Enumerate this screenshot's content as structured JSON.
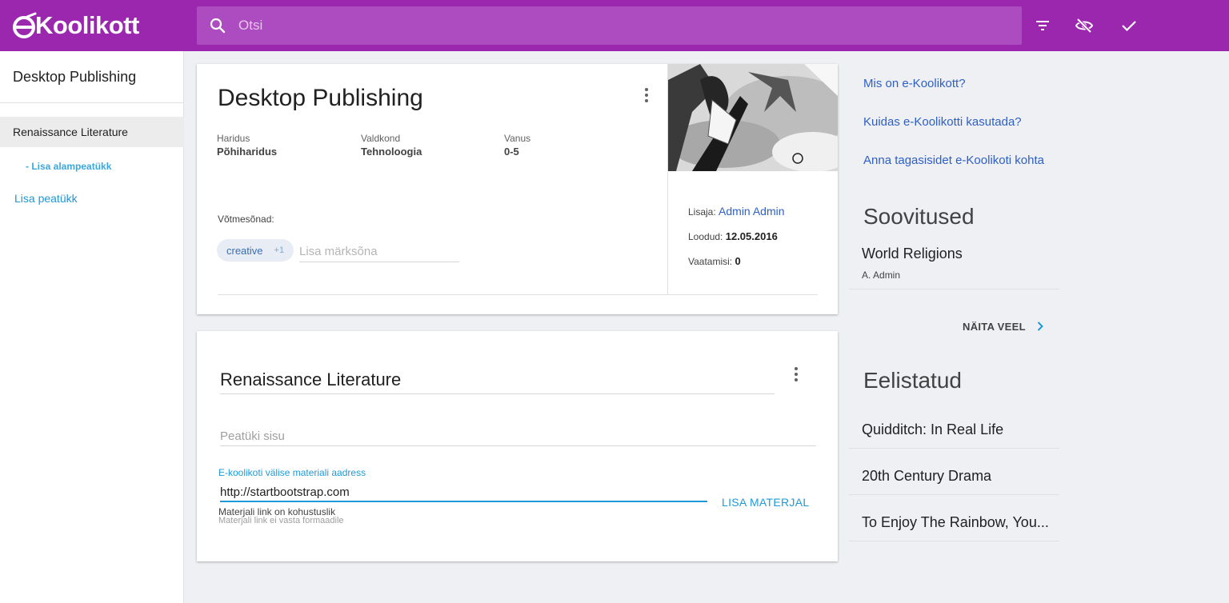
{
  "header": {
    "logo_text": "Koolikott",
    "search_placeholder": "Otsi",
    "icons": [
      "search-icon",
      "filter-icon",
      "visibility-off-icon",
      "check-icon"
    ],
    "colors": {
      "primary": "#9b27af",
      "search_bg": "#ad4bc0"
    }
  },
  "sidebar": {
    "title": "Desktop Publishing",
    "chapter": "Renaissance Literature",
    "add_subchapter": "- Lisa alampeatükk",
    "add_chapter": "Lisa peatükk"
  },
  "portfolio": {
    "title": "Desktop Publishing",
    "meta": [
      {
        "label": "Haridus",
        "value": "Põhiharidus"
      },
      {
        "label": "Valdkond",
        "value": "Tehnoloogia"
      },
      {
        "label": "Vanus",
        "value": "0-5"
      }
    ],
    "keywords_label": "Võtmesõnad:",
    "tag": "creative",
    "tag_extra": "+1",
    "keyword_placeholder": "Lisa märksõna",
    "creator_label": "Lisaja:",
    "creator": "Admin Admin",
    "created_label": "Loodud:",
    "created": "12.05.2016",
    "views_label": "Vaatamisi:",
    "views": "0"
  },
  "chapter": {
    "title": "Renaissance Literature",
    "content_placeholder": "Peatüki sisu",
    "url_label": "E-koolikoti välise materiali aadress",
    "url_value": "http://startbootstrap.com",
    "error_required": "Materjali link on kohustuslik",
    "error_format": "Materjali link ei vasta formaadile",
    "add_material": "LISA MATERJAL"
  },
  "right": {
    "links": [
      "Mis on e-Koolikott?",
      "Kuidas e-Koolikotti kasutada?",
      "Anna tagasisidet e-Koolikoti kohta"
    ],
    "recommendations_title": "Soovitused",
    "recommendation": {
      "title": "World Religions",
      "author": "A. Admin"
    },
    "show_more": "NÄITA VEEL",
    "favorites_title": "Eelistatud",
    "favorites": [
      "Quidditch: In Real Life",
      "20th Century Drama",
      "To Enjoy The Rainbow, You..."
    ],
    "link_color": "#2e5fc4",
    "accent": "#1e9ad8"
  }
}
